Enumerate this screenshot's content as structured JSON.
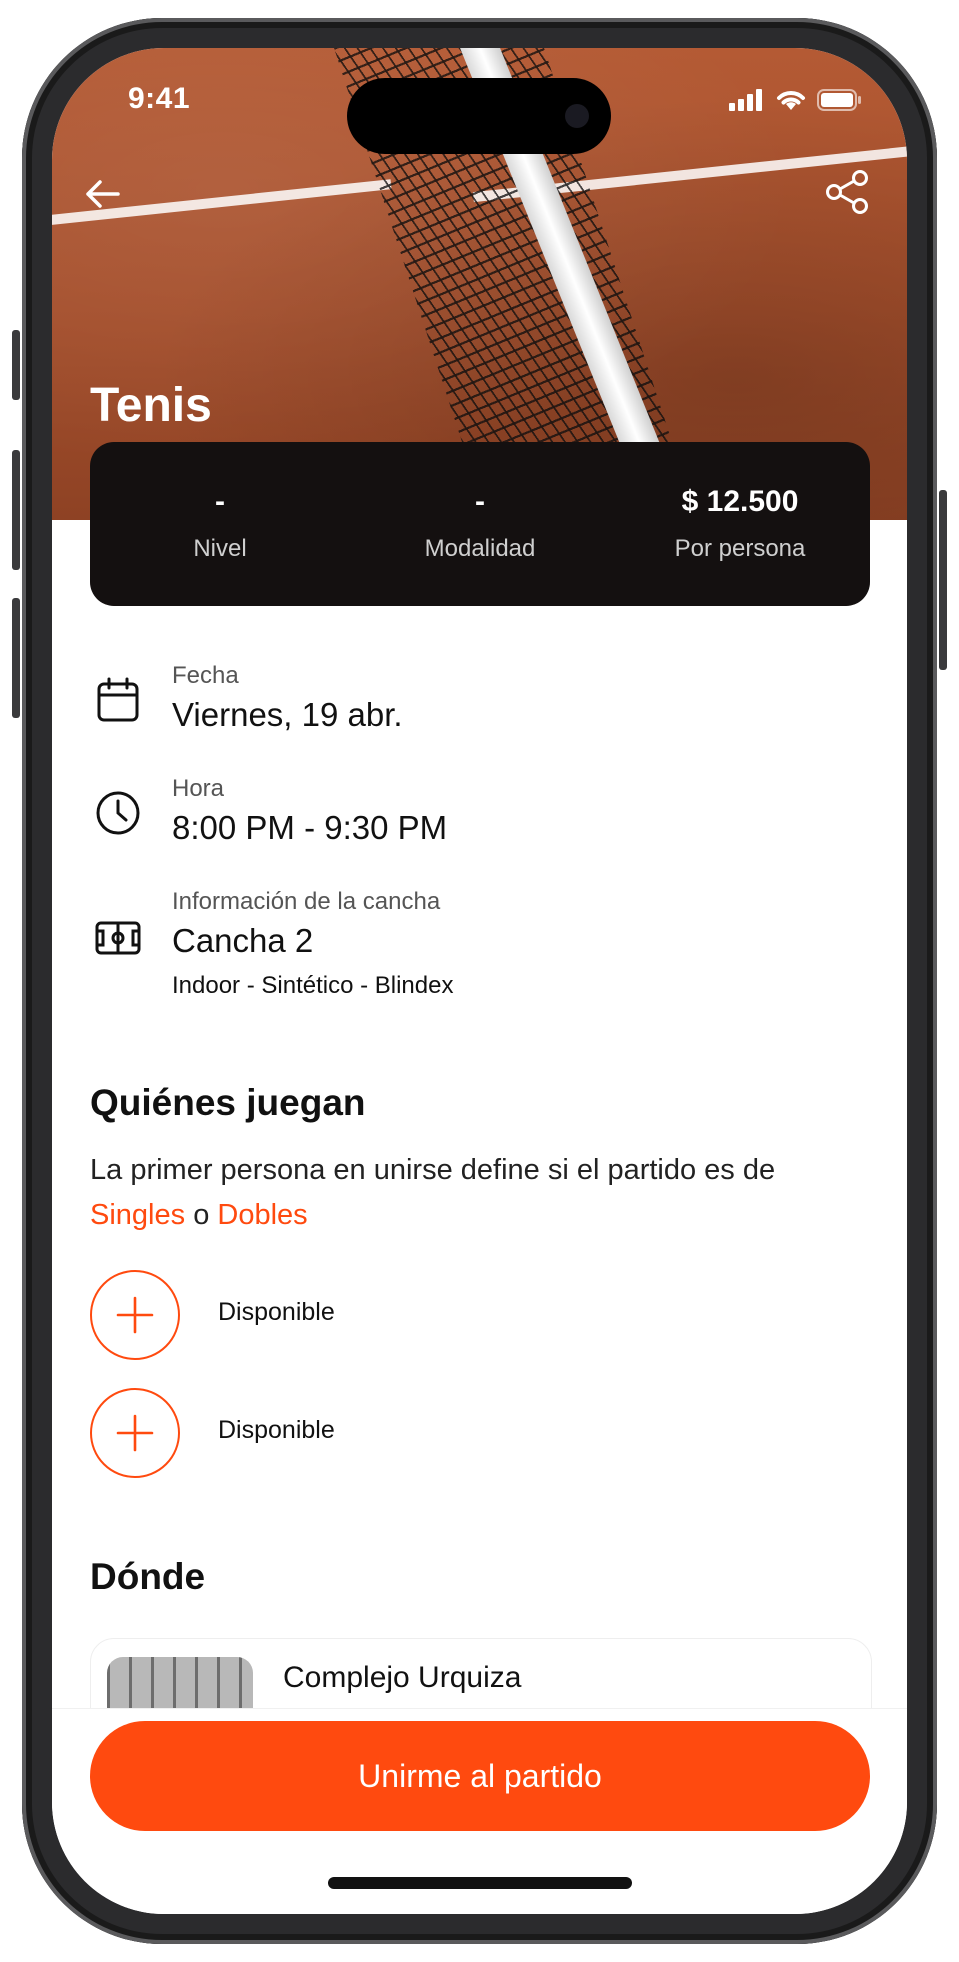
{
  "status_bar": {
    "time": "9:41"
  },
  "header": {
    "title": "Tenis",
    "back_icon": "arrow-left-icon",
    "share_icon": "share-icon"
  },
  "stats": [
    {
      "value": "-",
      "label": "Nivel"
    },
    {
      "value": "-",
      "label": "Modalidad"
    },
    {
      "value": "$ 12.500",
      "label": "Por persona"
    }
  ],
  "details": {
    "date": {
      "label": "Fecha",
      "value": "Viernes, 19 abr."
    },
    "time": {
      "label": "Hora",
      "value": "8:00 PM - 9:30 PM"
    },
    "court": {
      "label": "Información de la cancha",
      "value": "Cancha 2",
      "sub": "Indoor - Sintético - Blindex"
    }
  },
  "players": {
    "heading": "Quiénes juegan",
    "desc_prefix": "La primer persona en unirse define si el partido es de",
    "singles": "Singles",
    "connector": "o",
    "dobles": "Dobles",
    "slots": [
      "Disponible",
      "Disponible"
    ]
  },
  "where": {
    "heading": "Dónde",
    "venue": "Complejo Urquiza"
  },
  "cta": {
    "label": "Unirme al partido"
  },
  "colors": {
    "accent": "#ff4a0f",
    "dark_card": "#141010",
    "court": "#b45a34"
  }
}
